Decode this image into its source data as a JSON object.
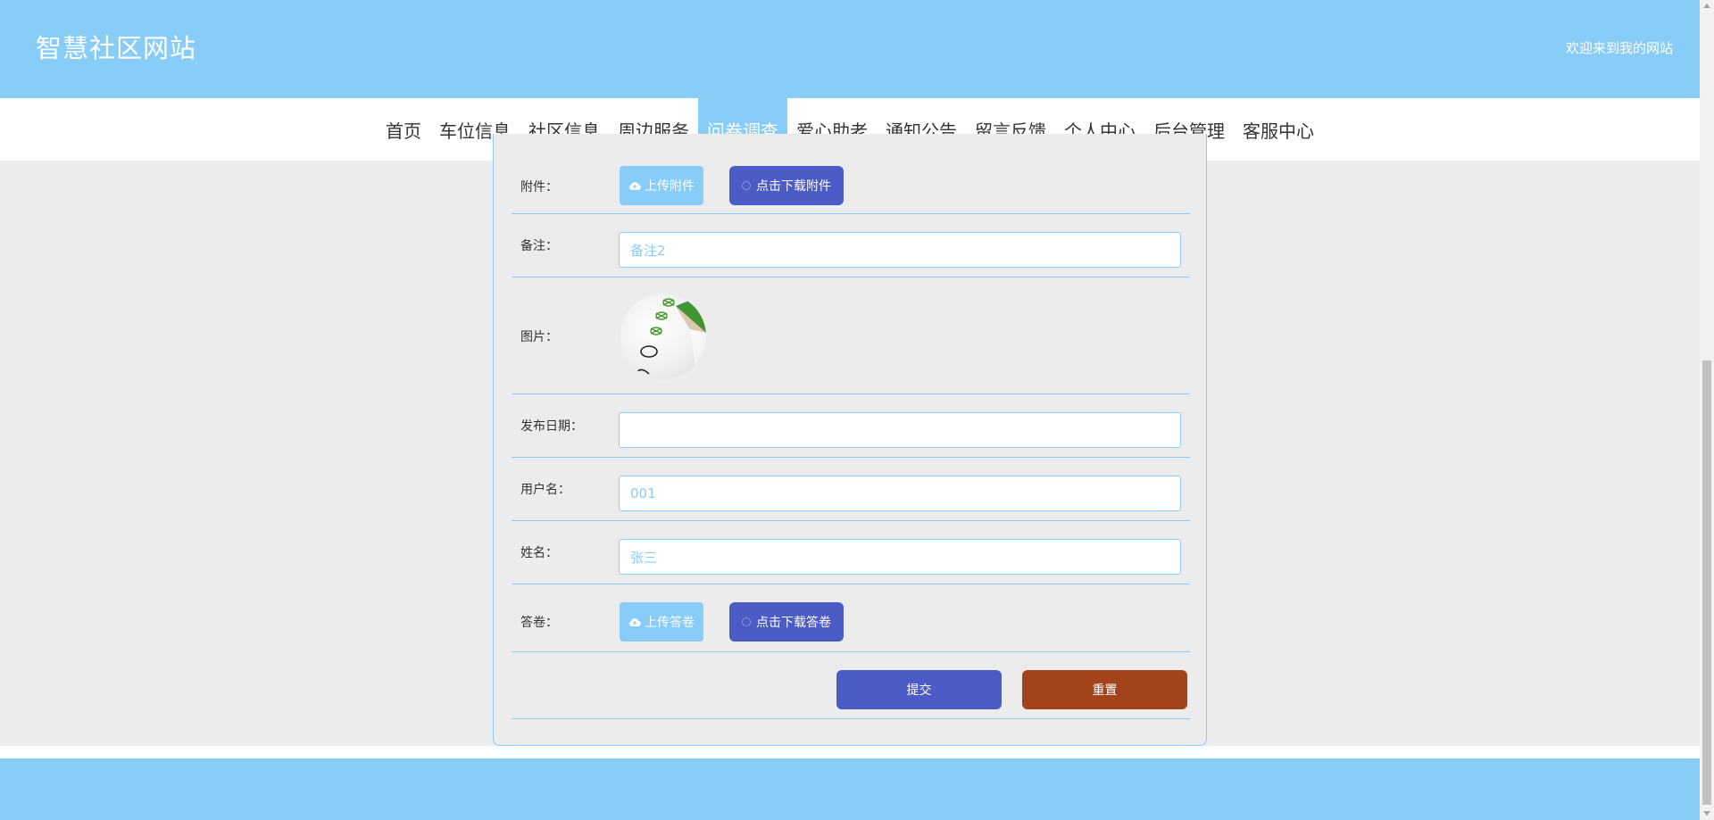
{
  "header": {
    "title": "智慧社区网站",
    "welcome": "欢迎来到我的网站"
  },
  "nav": {
    "items": [
      "首页",
      "车位信息",
      "社区信息",
      "周边服务",
      "问卷调查",
      "爱心助老",
      "通知公告",
      "留言反馈",
      "个人中心",
      "后台管理",
      "客服中心"
    ],
    "active": "问卷调查"
  },
  "form": {
    "attachment": {
      "label": "附件：",
      "upload_label": "上传附件",
      "download_label": "点击下载附件"
    },
    "remark": {
      "label": "备注：",
      "value": "备注2"
    },
    "image": {
      "label": "图片："
    },
    "publish_date": {
      "label": "发布日期：",
      "value": ""
    },
    "username": {
      "label": "用户名：",
      "value": "001"
    },
    "name": {
      "label": "姓名：",
      "value": "张三"
    },
    "answer": {
      "label": "答卷：",
      "upload_label": "上传答卷",
      "download_label": "点击下载答卷"
    },
    "submit_label": "提交",
    "reset_label": "重置"
  },
  "colors": {
    "primary_light": "#88cdf8",
    "primary_dark": "#4c5cc6",
    "reset": "#a2431b",
    "background": "#ececec"
  }
}
